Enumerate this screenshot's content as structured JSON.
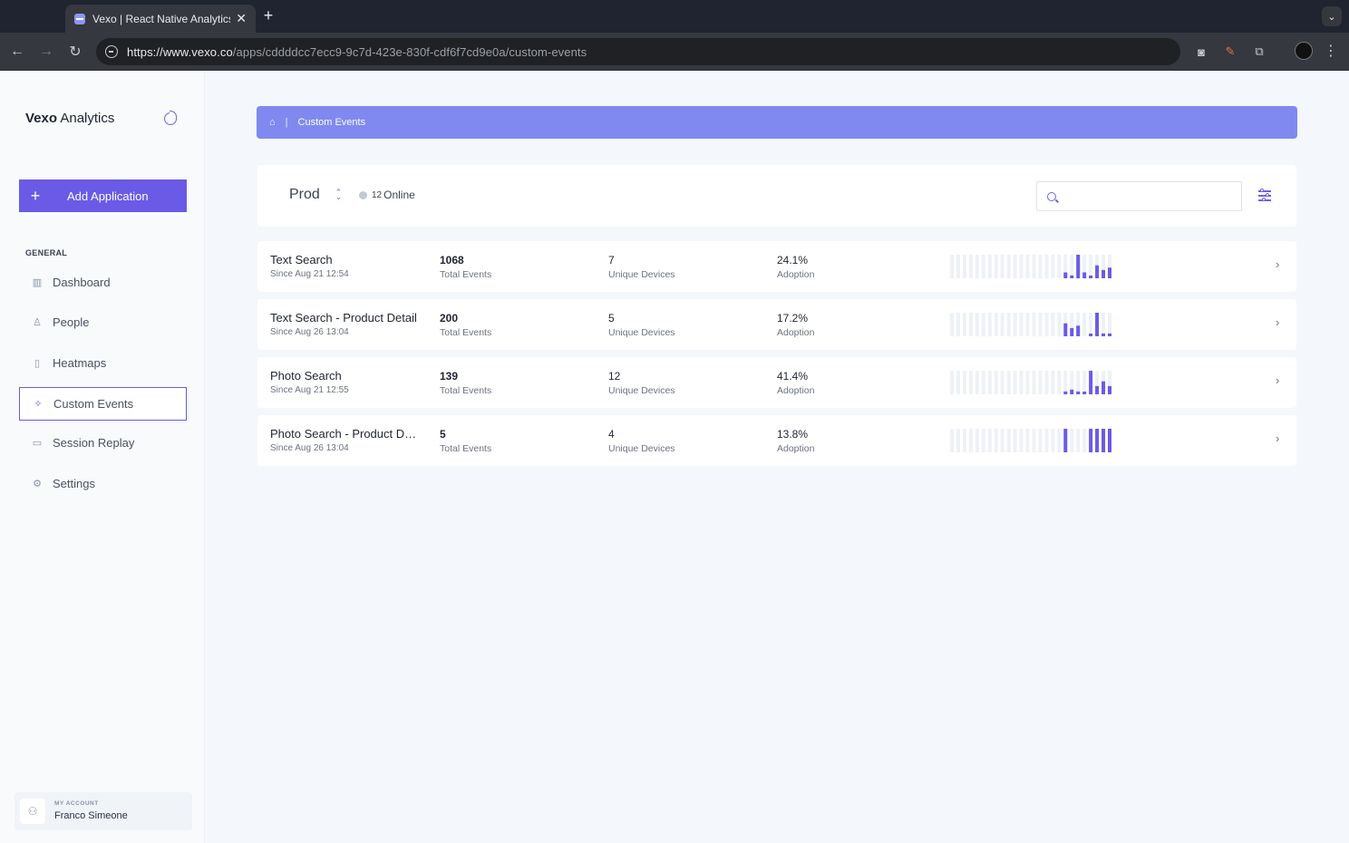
{
  "browser": {
    "tab_title": "Vexo | React Native Analytics",
    "tab_close": "✕",
    "new_tab": "+",
    "url_host": "https://www.vexo.co",
    "url_path": "/apps/cddddcc7ecc9-9c7d-423e-830f-cdf6f7cd9e0a/custom-events"
  },
  "sidebar": {
    "brand_bold": "Vexo",
    "brand_rest": " Analytics",
    "add_button": "Add Application",
    "section": "GENERAL",
    "items": [
      {
        "label": "Dashboard",
        "icon": "bar-chart-icon"
      },
      {
        "label": "People",
        "icon": "person-icon"
      },
      {
        "label": "Heatmaps",
        "icon": "phone-icon"
      },
      {
        "label": "Custom Events",
        "icon": "sparkles-icon",
        "active": true
      },
      {
        "label": "Session Replay",
        "icon": "video-icon"
      },
      {
        "label": "Settings",
        "icon": "gear-icon"
      }
    ],
    "account": {
      "label": "MY ACCOUNT",
      "name": "Franco Simeone"
    }
  },
  "breadcrumb": {
    "sep": "|",
    "current": "Custom Events"
  },
  "filters": {
    "environment": "Prod",
    "online_count": "12",
    "online_label": "Online",
    "search_placeholder": ""
  },
  "events": [
    {
      "name": "Text Search",
      "since": "Since Aug 21 12:54",
      "total": "1068",
      "total_label": "Total Events",
      "devices": "7",
      "devices_label": "Unique Devices",
      "adoption": "24.1%",
      "adoption_label": "Adoption",
      "spark": [
        0,
        0,
        0,
        0,
        0,
        0,
        0,
        0,
        0,
        0,
        0,
        0,
        0,
        0,
        0,
        0,
        0,
        0,
        0.25,
        0.12,
        1,
        0.25,
        0.08,
        0.55,
        0.35,
        0.45
      ]
    },
    {
      "name": "Text Search - Product Detail",
      "since": "Since Aug 26 13:04",
      "total": "200",
      "total_label": "Total Events",
      "devices": "5",
      "devices_label": "Unique Devices",
      "adoption": "17.2%",
      "adoption_label": "Adoption",
      "spark": [
        0,
        0,
        0,
        0,
        0,
        0,
        0,
        0,
        0,
        0,
        0,
        0,
        0,
        0,
        0,
        0,
        0,
        0,
        0.55,
        0.35,
        0.45,
        0,
        0.08,
        1,
        0.12,
        0.12
      ]
    },
    {
      "name": "Photo Search",
      "since": "Since Aug 21 12:55",
      "total": "139",
      "total_label": "Total Events",
      "devices": "12",
      "devices_label": "Unique Devices",
      "adoption": "41.4%",
      "adoption_label": "Adoption",
      "spark": [
        0,
        0,
        0,
        0,
        0,
        0,
        0,
        0,
        0,
        0,
        0,
        0,
        0,
        0,
        0,
        0,
        0,
        0,
        0.12,
        0.2,
        0.12,
        0.08,
        1,
        0.35,
        0.55,
        0.35
      ]
    },
    {
      "name": "Photo Search - Product Det…",
      "since": "Since Aug 26 13:04",
      "total": "5",
      "total_label": "Total Events",
      "devices": "4",
      "devices_label": "Unique Devices",
      "adoption": "13.8%",
      "adoption_label": "Adoption",
      "spark": [
        0,
        0,
        0,
        0,
        0,
        0,
        0,
        0,
        0,
        0,
        0,
        0,
        0,
        0,
        0,
        0,
        0,
        0,
        1,
        0,
        0,
        0,
        1,
        1,
        1,
        1
      ]
    }
  ],
  "colors": {
    "accent": "#6a5ae6",
    "breadcrumb": "#7f89ef",
    "spark_bg": "#eef1f7"
  }
}
